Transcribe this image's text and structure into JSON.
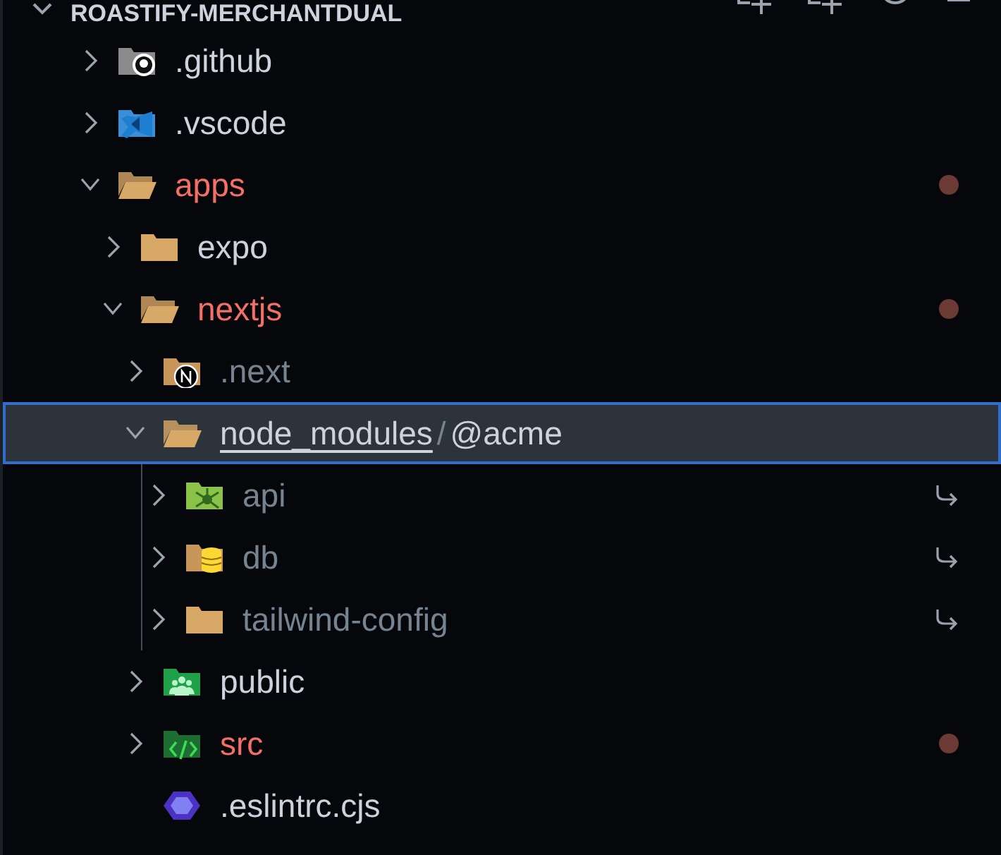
{
  "header": {
    "title": "ROASTIFY-MERCHANTDUAL",
    "expanded": true
  },
  "tree": [
    {
      "label": ".github",
      "kind": "github",
      "expanded": false,
      "selected": false,
      "modified": false,
      "dimmed": false,
      "symlink": false
    },
    {
      "label": ".vscode",
      "kind": "vscode",
      "expanded": false,
      "selected": false,
      "modified": false,
      "dimmed": false,
      "symlink": false
    },
    {
      "label": "apps",
      "kind": "folder",
      "expanded": true,
      "selected": false,
      "modified": true,
      "dimmed": false,
      "symlink": false,
      "children": [
        {
          "label": "expo",
          "kind": "folder",
          "expanded": false,
          "selected": false,
          "modified": false,
          "dimmed": false,
          "symlink": false
        },
        {
          "label": "nextjs",
          "kind": "folder",
          "expanded": true,
          "selected": false,
          "modified": true,
          "dimmed": false,
          "symlink": false,
          "children": [
            {
              "label": ".next",
              "kind": "next",
              "expanded": false,
              "selected": false,
              "modified": false,
              "dimmed": true,
              "symlink": false
            },
            {
              "segments": [
                "node_modules",
                "@acme"
              ],
              "separator": "/",
              "kind": "folder",
              "expanded": true,
              "selected": true,
              "modified": false,
              "dimmed": false,
              "symlink": false,
              "children": [
                {
                  "label": "api",
                  "kind": "api",
                  "expanded": false,
                  "selected": false,
                  "modified": false,
                  "dimmed": true,
                  "symlink": true
                },
                {
                  "label": "db",
                  "kind": "db",
                  "expanded": false,
                  "selected": false,
                  "modified": false,
                  "dimmed": true,
                  "symlink": true
                },
                {
                  "label": "tailwind-config",
                  "kind": "folder",
                  "expanded": false,
                  "selected": false,
                  "modified": false,
                  "dimmed": true,
                  "symlink": true
                }
              ]
            },
            {
              "label": "public",
              "kind": "public",
              "expanded": false,
              "selected": false,
              "modified": false,
              "dimmed": false,
              "symlink": false
            },
            {
              "label": "src",
              "kind": "src",
              "expanded": false,
              "selected": false,
              "modified": true,
              "dimmed": false,
              "symlink": false
            },
            {
              "label": ".eslintrc.cjs",
              "kind": "file",
              "expanded": false,
              "selected": false,
              "modified": false,
              "dimmed": false,
              "symlink": false
            }
          ]
        }
      ]
    }
  ]
}
